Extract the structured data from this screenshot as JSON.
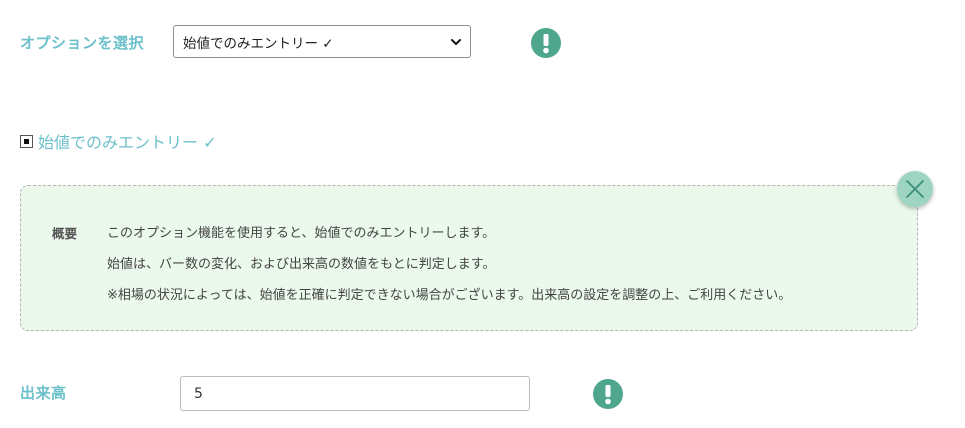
{
  "option_select": {
    "label": "オプションを選択",
    "selected": "始値でのみエントリー ✓"
  },
  "entry_checkbox": {
    "label": "始値でのみエントリー ✓",
    "checked": true
  },
  "info_panel": {
    "heading": "概要",
    "lines": [
      "このオプション機能を使用すると、始値でのみエントリーします。",
      "始値は、バー数の変化、および出来高の数値をもとに判定します。",
      "※相場の状況によっては、始値を正確に判定できない場合がございます。出来高の設定を調整の上、ご利用ください。"
    ]
  },
  "volume": {
    "label": "出来高",
    "value": "5"
  },
  "colors": {
    "label_accent": "#6cc0cb",
    "alert_green": "#4ea78c",
    "panel_bg": "#ebf9ed",
    "close_btn": "#9dd4c2"
  },
  "icons": {
    "alert": "exclamation-circle-icon",
    "close": "close-icon",
    "dropdown": "chevron-down-icon"
  }
}
